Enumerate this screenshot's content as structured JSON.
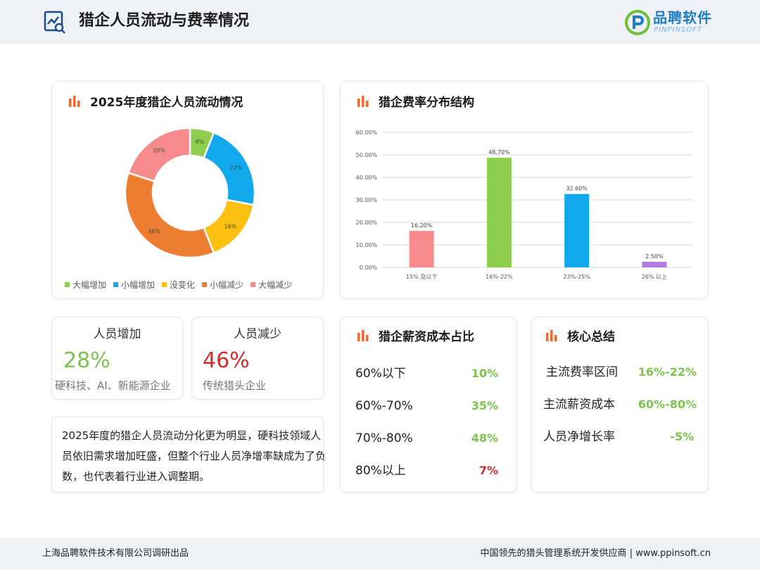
{
  "header": {
    "title": "猎企人员流动与费率情况",
    "logo_text": "品聘软件",
    "logo_sub": "PINPINSOFT"
  },
  "donut_card": {
    "title": "2025年度猎企人员流动情况"
  },
  "bar_card": {
    "title": "猎企费率分布结构"
  },
  "chart_data": [
    {
      "type": "pie",
      "title": "2025年度猎企人员流动情况",
      "categories": [
        "大幅增加",
        "小幅增加",
        "没变化",
        "小幅减少",
        "大幅减少"
      ],
      "values": [
        6,
        22,
        16,
        36,
        20
      ],
      "labels": [
        "6%",
        "22%",
        "16%",
        "36%",
        "20%"
      ],
      "colors": [
        "#8dce4c",
        "#12a9ec",
        "#fbc010",
        "#ed7d31",
        "#f78a8a"
      ],
      "legend_position": "bottom"
    },
    {
      "type": "bar",
      "title": "猎企费率分布结构",
      "categories": [
        "15% 及以下",
        "16%-22%",
        "23%-25%",
        "26% 以上"
      ],
      "values": [
        16.2,
        48.7,
        32.6,
        2.5
      ],
      "labels": [
        "16.20%",
        "48.70%",
        "32.60%",
        "2.50%"
      ],
      "colors": [
        "#f78a8a",
        "#8dce4c",
        "#12a9ec",
        "#b47ae0"
      ],
      "ylim": [
        0,
        60
      ],
      "yticks": [
        "0.00%",
        "10.00%",
        "20.00%",
        "30.00%",
        "40.00%",
        "50.00%",
        "60.00%"
      ],
      "grid": true
    }
  ],
  "stats": [
    {
      "label": "人员增加",
      "value": "28%",
      "desc": "硬科技、AI、新能源企业",
      "color": "#7cc34d"
    },
    {
      "label": "人员减少",
      "value": "46%",
      "desc": "传统猎头企业",
      "color": "#d42a2a"
    }
  ],
  "summary": {
    "text": "2025年度的猎企人员流动分化更为明显，硬科技领域人员依旧需求增加旺盛，但整个行业人员净增率缺成为了负数，也代表着行业进入调整期。"
  },
  "salary_card": {
    "title": "猎企薪资成本占比",
    "rows": [
      {
        "label": "60%以下",
        "value": "10%",
        "color": "#7cc34d"
      },
      {
        "label": "60%-70%",
        "value": "35%",
        "color": "#7cc34d"
      },
      {
        "label": "70%-80%",
        "value": "48%",
        "color": "#7cc34d"
      },
      {
        "label": "80%以上",
        "value": "7%",
        "color": "#d42a2a"
      }
    ]
  },
  "core_card": {
    "title": "核心总结",
    "rows": [
      {
        "label": "主流费率区间",
        "value": "16%-22%",
        "color": "#7cc34d"
      },
      {
        "label": "主流薪资成本",
        "value": "60%-80%",
        "color": "#7cc34d"
      },
      {
        "label": "人员净增长率",
        "value": "-5%",
        "color": "#7cc34d"
      }
    ]
  },
  "footer": {
    "left": "上海品聘软件技术有限公司调研出品",
    "right": "中国领先的猎头管理系统开发供应商 | www.ppinsoft.cn"
  }
}
